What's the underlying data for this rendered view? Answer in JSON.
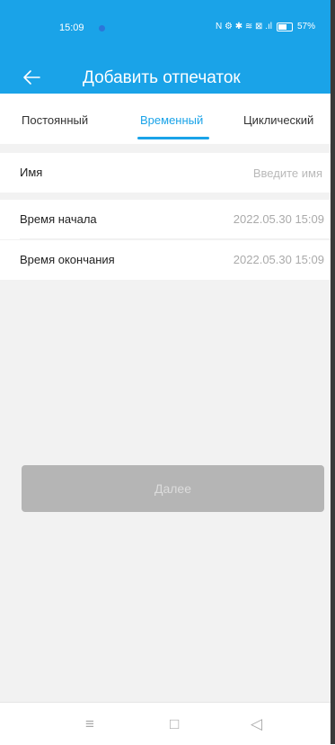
{
  "status_bar": {
    "time": "15:09",
    "icons_text": "N ⚙ ✱ ≋ ⊠ .ıl",
    "battery": "57%"
  },
  "header": {
    "title": "Добавить отпечаток",
    "back_icon": "arrow-left-icon"
  },
  "tabs": [
    {
      "label": "Постоянный",
      "active": false
    },
    {
      "label": "Временный",
      "active": true
    },
    {
      "label": "Циклический",
      "active": false
    }
  ],
  "form": {
    "name_label": "Имя",
    "name_placeholder": "Введите имя",
    "start_label": "Время начала",
    "start_value": "2022.05.30 15:09",
    "end_label": "Время окончания",
    "end_value": "2022.05.30 15:09"
  },
  "next_button": "Далее",
  "nav": {
    "menu_icon": "≡",
    "home_icon": "□",
    "back_icon": "◁"
  },
  "colors": {
    "accent": "#1aa3e8",
    "button_disabled": "#b5b5b5"
  }
}
